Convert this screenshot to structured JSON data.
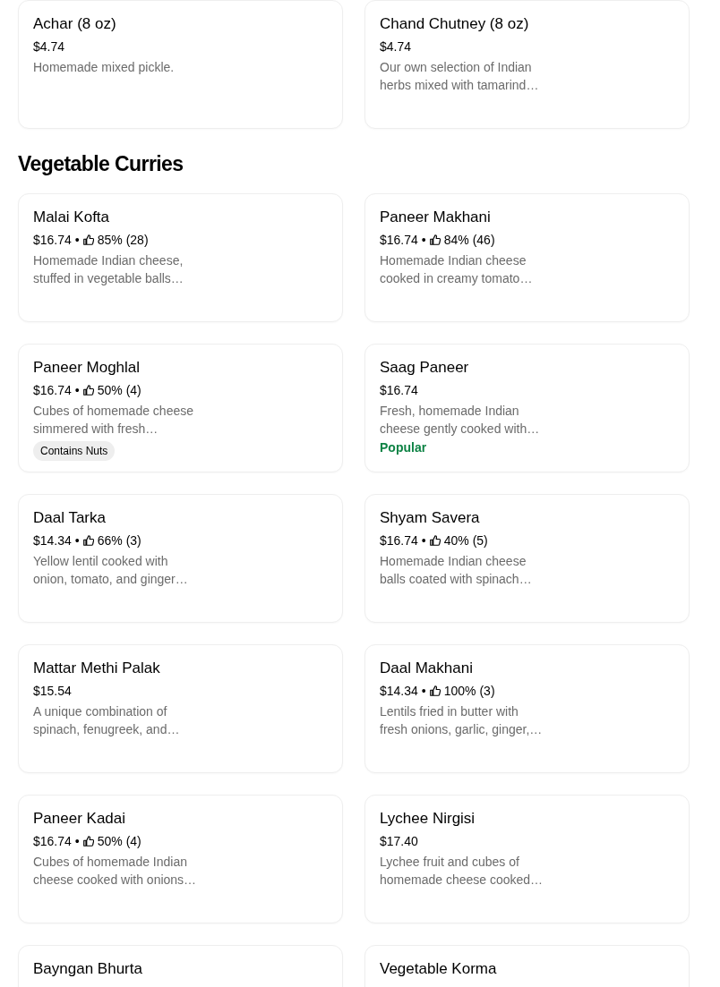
{
  "top_items": [
    {
      "name": "Achar (8 oz)",
      "price": "$4.74",
      "description": "Homemade mixed pickle."
    },
    {
      "name": "Chand Chutney (8 oz)",
      "price": "$4.74",
      "description": "Our own selection of Indian herbs mixed with tamarind…"
    }
  ],
  "section": {
    "title": "Vegetable Curries",
    "items": [
      {
        "name": "Malai Kofta",
        "price": "$16.74",
        "separator": "•",
        "rating": "85% (28)",
        "description": "Homemade Indian cheese, stuffed in vegetable balls…"
      },
      {
        "name": "Paneer Makhani",
        "price": "$16.74",
        "separator": "•",
        "rating": "84% (46)",
        "description": "Homemade Indian cheese cooked in creamy tomato…"
      },
      {
        "name": "Paneer Moghlal",
        "price": "$16.74",
        "separator": "•",
        "rating": "50% (4)",
        "description": "Cubes of homemade cheese simmered with fresh…",
        "badge": {
          "kind": "tag",
          "text": "Contains Nuts"
        }
      },
      {
        "name": "Saag Paneer",
        "price": "$16.74",
        "description": "Fresh, homemade Indian cheese gently cooked with…",
        "badge": {
          "kind": "highlight",
          "text": "Popular"
        }
      },
      {
        "name": "Daal Tarka",
        "price": "$14.34",
        "separator": "•",
        "rating": "66% (3)",
        "description": "Yellow lentil cooked with onion, tomato, and ginger…"
      },
      {
        "name": "Shyam Savera",
        "price": "$16.74",
        "separator": "•",
        "rating": "40% (5)",
        "description": "Homemade Indian cheese balls coated with spinach…"
      },
      {
        "name": "Mattar Methi Palak",
        "price": "$15.54",
        "description": "A unique combination of spinach, fenugreek, and…"
      },
      {
        "name": "Daal Makhani",
        "price": "$14.34",
        "separator": "•",
        "rating": "100% (3)",
        "description": "Lentils fried in butter with fresh onions, garlic, ginger,…"
      },
      {
        "name": "Paneer Kadai",
        "price": "$16.74",
        "separator": "•",
        "rating": "50% (4)",
        "description": "Cubes of homemade Indian cheese cooked with onions…"
      },
      {
        "name": "Lychee Nirgisi",
        "price": "$17.40",
        "description": "Lychee fruit and cubes of homemade cheese cooked…"
      },
      {
        "name": "Bayngan Bhurta"
      },
      {
        "name": "Vegetable Korma"
      }
    ]
  }
}
